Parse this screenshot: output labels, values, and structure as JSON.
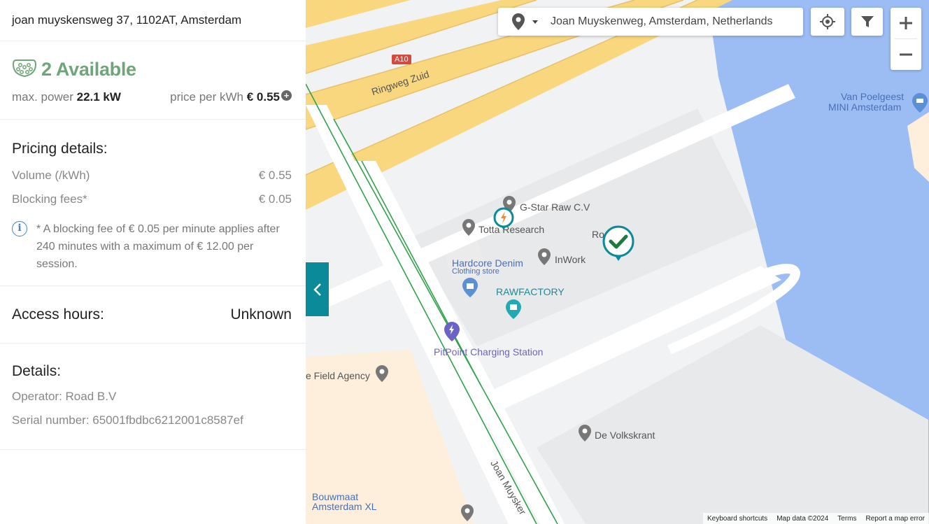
{
  "panel": {
    "address": "joan muyskensweg 37, 1102AT, Amsterdam",
    "availability": "2 Available",
    "max_power_label": "max. power",
    "max_power_value": "22.1 kW",
    "price_label": "price per kWh",
    "price_value": "€ 0.55",
    "pricing": {
      "title": "Pricing details:",
      "rows": [
        {
          "label": "Volume (/kWh)",
          "value": "€ 0.55"
        },
        {
          "label": "Blocking fees*",
          "value": "€ 0.05"
        }
      ],
      "note": "* A blocking fee of € 0.05 per minute applies after 240 minutes with a maximum of € 12.00 per session."
    },
    "access": {
      "label": "Access hours:",
      "value": "Unknown"
    },
    "details": {
      "title": "Details:",
      "operator": "Operator: Road B.V",
      "serial": "Serial number: 65001fbdbc6212001c8587ef"
    }
  },
  "map": {
    "search_value": "Joan Muyskenweg, Amsterdam, Netherlands",
    "labels": {
      "a10": "A10",
      "ringweg": "Ringweg Zuid",
      "gstar": "G-Star Raw C.V",
      "totta": "Totta Research",
      "ro": "Ro",
      "hardcore": "Hardcore Denim",
      "clothing": "Clothing store",
      "inwork": "InWork",
      "rawfactory": "RAWFACTORY",
      "pitpoint": "PitPoint Charging Station",
      "field": "e Field Agency",
      "volkskrant": "De Volkskrant",
      "bouwmaat1": "Bouwmaat",
      "bouwmaat2": "Amsterdam XL",
      "joan": "Joan Muysker",
      "vanpoel1": "Van Poelgeest",
      "vanpoel2": "MINI Amsterdam"
    },
    "attribution": {
      "shortcuts": "Keyboard shortcuts",
      "data": "Map data ©2024",
      "terms": "Terms",
      "report": "Report a map error"
    },
    "colors": {
      "water": "#9cbdf4",
      "highway": "#f9d77e",
      "teal": "#0b8a9a",
      "available": "#6fa57a"
    }
  }
}
